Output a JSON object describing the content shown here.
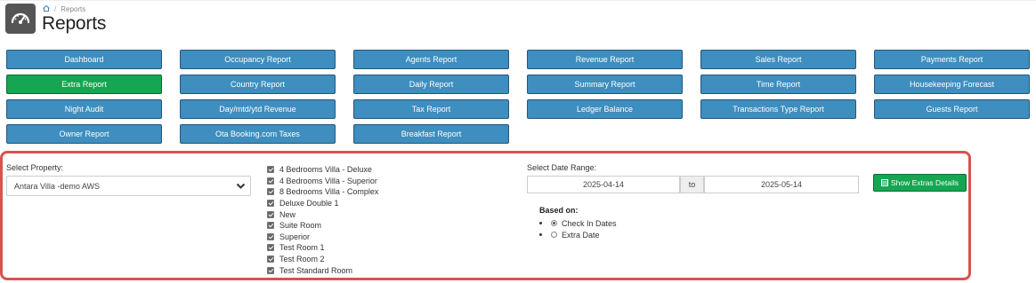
{
  "breadcrumb": {
    "current": "Reports"
  },
  "page_title": "Reports",
  "report_buttons": [
    [
      "Dashboard",
      "Occupancy Report",
      "Agents Report",
      "Revenue Report",
      "Sales Report",
      "Payments Report"
    ],
    [
      "Extra Report",
      "Country Report",
      "Daily Report",
      "Summary Report",
      "Time Report",
      "Housekeeping Forecast"
    ],
    [
      "Night Audit",
      "Day/mtd/ytd Revenue",
      "Tax Report",
      "Ledger Balance",
      "Transactions Type Report",
      "Guests Report"
    ],
    [
      "Owner Report",
      "Ota Booking.com Taxes",
      "Breakfast Report"
    ]
  ],
  "active_report": "Extra Report",
  "filters": {
    "property_label": "Select Property:",
    "property_value": "Antara Villa -demo AWS",
    "rooms": [
      "4 Bedrooms Villa - Deluxe",
      "4 Bedrooms Villa - Superior",
      "8 Bedrooms Villa - Complex",
      "Deluxe Double 1",
      "New",
      "Suite Room",
      "Superior",
      "Test Room 1",
      "Test Room 2",
      "Test Standard Room"
    ],
    "date_range_label": "Select Date Range:",
    "date_from": "2025-04-14",
    "date_to_label": "to",
    "date_to": "2025-05-14",
    "based_on_label": "Based on:",
    "based_on_options": [
      "Check In Dates",
      "Extra Date"
    ],
    "based_on_selected": "Check In Dates",
    "show_button_label": "Show Extras Details"
  },
  "colors": {
    "report_button": "#3e8ebf",
    "active_button": "#14a651",
    "panel_border": "#d9534f"
  }
}
